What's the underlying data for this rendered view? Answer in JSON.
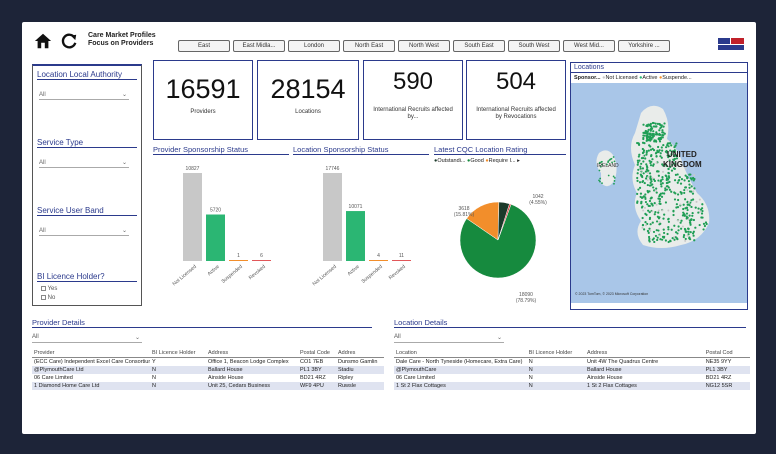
{
  "header": {
    "title_line1": "Care Market Profiles",
    "title_line2": "Focus on Providers",
    "regions": [
      "East",
      "East Midla...",
      "London",
      "North East",
      "North West",
      "South East",
      "South West",
      "West Mid...",
      "Yorkshire ..."
    ]
  },
  "filters": {
    "local_authority": {
      "label": "Location Local Authority",
      "value": "All"
    },
    "service_type": {
      "label": "Service Type",
      "value": "All"
    },
    "service_user_band": {
      "label": "Service User Band",
      "value": "All"
    },
    "bi_licence": {
      "label": "BI Licence Holder?",
      "options": [
        "Yes",
        "No"
      ]
    }
  },
  "kpis": [
    {
      "value": "16591",
      "label": "Providers"
    },
    {
      "value": "28154",
      "label": "Locations"
    },
    {
      "value": "590",
      "label": "International Recruits affected by..."
    },
    {
      "value": "504",
      "label": "International Recruits affected by Revocations"
    }
  ],
  "provider_status": {
    "title": "Provider Sponsorship Status",
    "chart_data": {
      "type": "bar",
      "categories": [
        "Not Licensed",
        "Active",
        "Suspended",
        "Revoked"
      ],
      "values": [
        10827,
        5720,
        1,
        6
      ],
      "labels": [
        "10827",
        "5720",
        "1",
        "6"
      ],
      "colors": [
        "#c8c8c8",
        "#2bb673",
        "#f28e2b",
        "#e15759"
      ]
    }
  },
  "location_status": {
    "title": "Location Sponsorship Status",
    "chart_data": {
      "type": "bar",
      "categories": [
        "Not Licensed",
        "Active",
        "Suspended",
        "Revoked"
      ],
      "values": [
        17746,
        10071,
        4,
        11
      ],
      "labels": [
        "17746",
        "10071",
        "4",
        "11"
      ],
      "colors": [
        "#c8c8c8",
        "#2bb673",
        "#f28e2b",
        "#e15759"
      ]
    }
  },
  "cqc_rating": {
    "title": "Latest CQC Location Rating",
    "legend": [
      "Outstandi...",
      "Good",
      "Require I..."
    ],
    "legend_colors": [
      "#1b3a2a",
      "#168a3e",
      "#f28e2b"
    ],
    "chart_data": {
      "type": "pie",
      "labels": [
        "Good",
        "Requires Improvement",
        "Outstanding",
        "Inadequate"
      ],
      "values": [
        18090,
        3618,
        1042,
        150
      ],
      "colors": [
        "#168a3e",
        "#f28e2b",
        "#1b3a2a",
        "#d62728"
      ],
      "annotations": [
        "18090 (78.79%)",
        "3618 (15.81%)",
        "1042 (4.55%)"
      ]
    }
  },
  "map": {
    "title": "Locations",
    "legend_label": "Sponsor...",
    "legend": [
      "Not Licensed",
      "Active",
      "Suspende..."
    ],
    "legend_colors": [
      "#c8c8c8",
      "#2bb673",
      "#f28e2b"
    ],
    "labels": {
      "country": "UNITED KINGDOM",
      "ireland": "IRELAND"
    },
    "credit": "© 2023 TomTom, © 2023 Microsoft Corporation"
  },
  "provider_details": {
    "title": "Provider Details",
    "filter": "All",
    "columns": [
      "Provider",
      "BI Licence Holder",
      "Address",
      "Postal Code",
      "Addres"
    ],
    "rows": [
      [
        "(ECC Care) Independent Excel Care Consortium Limited",
        "Y",
        "Office 1, Beacon Lodge Complex",
        "CO1 7EB",
        "Dunsmo Gamlin"
      ],
      [
        "@PlymouthCare Ltd",
        "N",
        "Ballard House",
        "PL1 3BY",
        "Stadiu"
      ],
      [
        "06 Care Limited",
        "N",
        "Ainside House",
        "BD21 4RZ",
        "Ripley"
      ],
      [
        "1 Diamond Home Care Ltd",
        "N",
        "Unit 25, Cedars Business",
        "WF9 4PU",
        "Ruwsle"
      ]
    ]
  },
  "location_details": {
    "title": "Location Details",
    "filter": "All",
    "columns": [
      "Location",
      "BI Licence Holder",
      "Address",
      "Postal Cod"
    ],
    "rows": [
      [
        "Dale Care - North Tyneside (Homecare, Extra Care)",
        "N",
        "Unit 4W The Quadrus Centre",
        "NE35 9YY"
      ],
      [
        "@PlymouthCare",
        "N",
        "Ballard House",
        "PL1 3BY"
      ],
      [
        "06 Care Limited",
        "N",
        "Ainside House",
        "BD21 4RZ"
      ],
      [
        "1 St 2 Flax Cottages",
        "N",
        "1 St 2 Flax Cottages",
        "NG12 5SR"
      ]
    ]
  }
}
